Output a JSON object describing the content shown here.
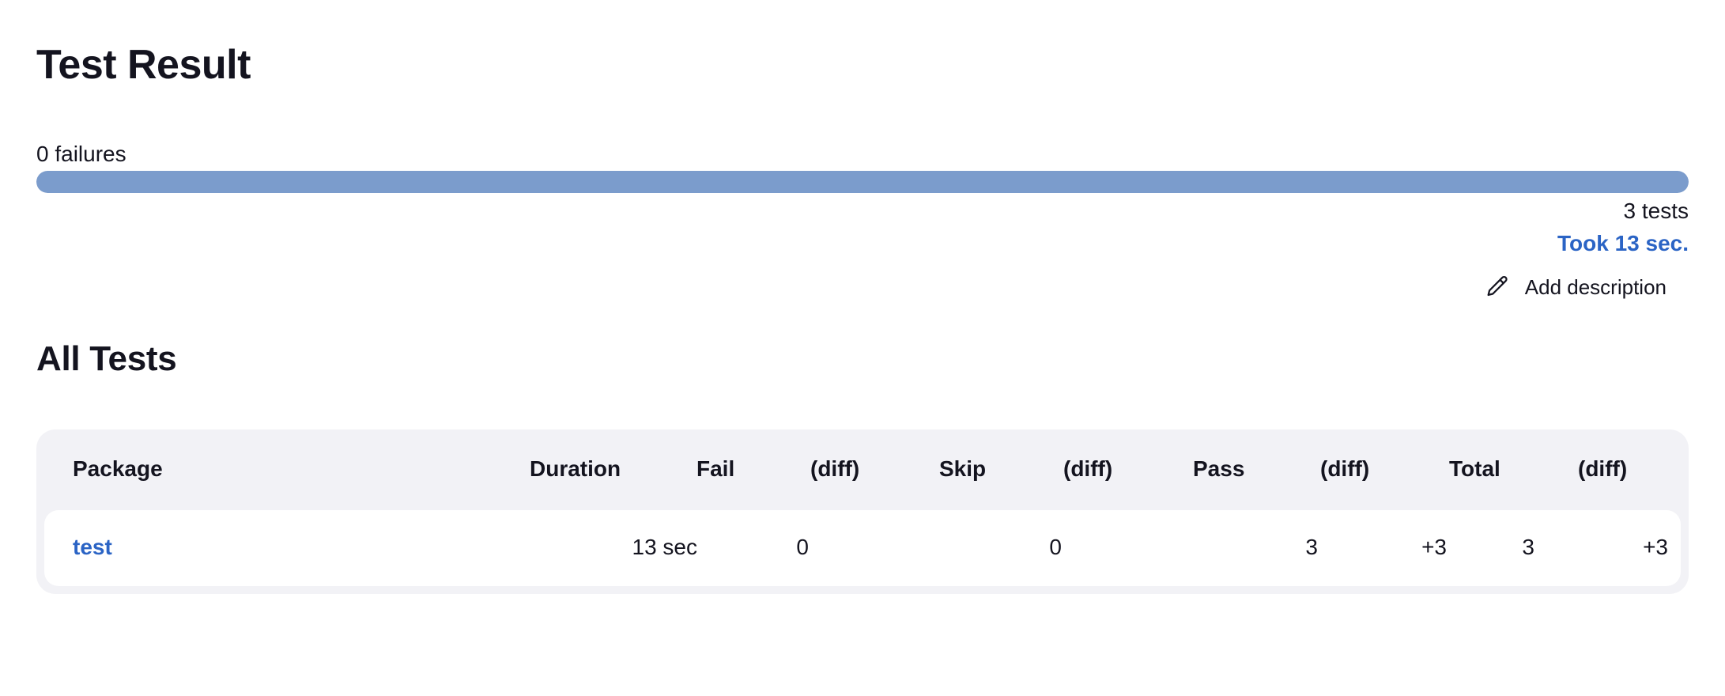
{
  "header": {
    "title": "Test Result"
  },
  "summary": {
    "failures_label": "0 failures",
    "pass_fraction": 1.0,
    "tests_label": "3 tests",
    "took_label": "Took 13 sec.",
    "add_description_label": "Add description",
    "colors": {
      "bar_pass": "#7b9ccc",
      "link": "#2b64c5"
    }
  },
  "all_tests": {
    "title": "All Tests",
    "columns": [
      "Package",
      "Duration",
      "Fail",
      "(diff)",
      "Skip",
      "(diff)",
      "Pass",
      "(diff)",
      "Total",
      "(diff)"
    ],
    "rows": [
      {
        "package": "test",
        "duration": "13 sec",
        "fail": "0",
        "fail_diff": "",
        "skip": "0",
        "skip_diff": "",
        "pass": "3",
        "pass_diff": "+3",
        "total": "3",
        "total_diff": "+3"
      }
    ]
  }
}
